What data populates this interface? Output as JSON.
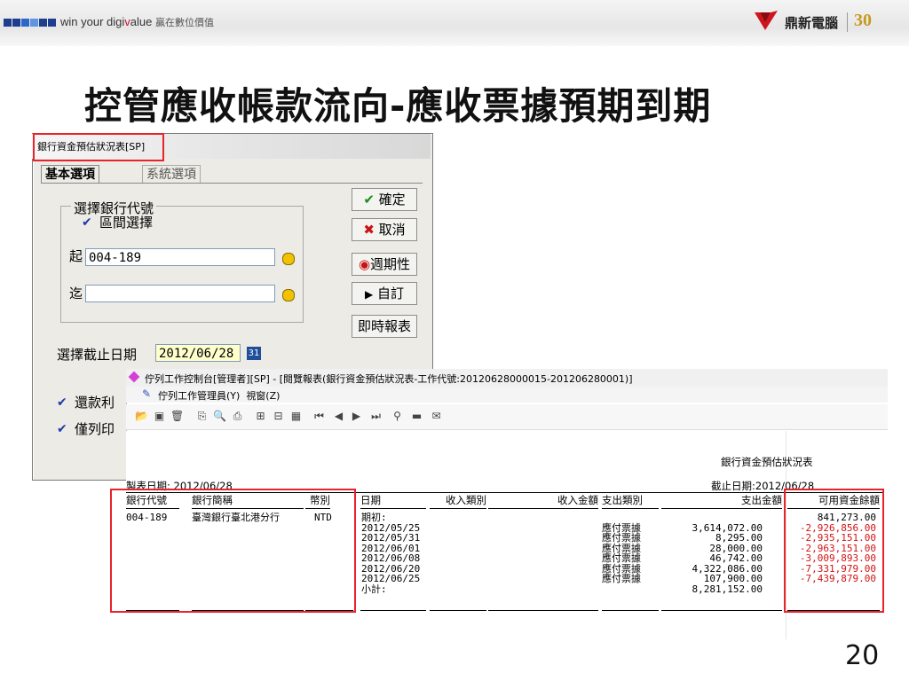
{
  "banner": {
    "tagline_a": "win your digi",
    "tagline_v": "v",
    "tagline_b": "alue",
    "tagline_cn": "贏在數位價值",
    "brand": "鼎新電腦",
    "anniversary": "30",
    "square_colors": [
      "#1f3d8f",
      "#1f3d8f",
      "#2d67c9",
      "#5f95e0",
      "#1f3d8f",
      "#1f3d8f",
      "#1f3d8f"
    ]
  },
  "slide_title": "控管應收帳款流向-應收票據預期到期",
  "dialog": {
    "title": "銀行資金預估狀況表[SP]",
    "tab_basic": "基本選項",
    "tab_system": "系統選項",
    "group_label": "選擇銀行代號",
    "range_checkbox": "區間選擇",
    "from_label": "起",
    "from_value": "004-189",
    "to_label": "迄",
    "to_value": "",
    "date_label": "選擇截止日期",
    "date_value": "2012/06/28",
    "calendar_glyph": "31",
    "check_repay": "還款利",
    "check_only": "僅列印",
    "buttons": {
      "ok": "確定",
      "cancel": "取消",
      "cycle": "週期性",
      "custom": "自訂",
      "instant": "即時報表"
    }
  },
  "report_window": {
    "title": "佇列工作控制台[管理者][SP] - [閱覽報表(銀行資金預估狀況表-工作代號:20120628000015-201206280001)]",
    "menu_queue": "佇列工作管理員(Y)",
    "menu_window": "視窗(Z)"
  },
  "report": {
    "title": "銀行資金預估狀況表",
    "print_date": "製表日期: 2012/06/28",
    "cutoff_date": "截止日期:2012/06/28",
    "headers": [
      "銀行代號",
      "銀行簡稱",
      "幣別",
      "日期",
      "收入類別",
      "收入金額",
      "支出類別",
      "支出金額",
      "可用資金餘額"
    ],
    "bank_code": "004-189",
    "bank_name": "臺灣銀行臺北港分行",
    "currency": "NTD",
    "dates": "期初:\n2012/05/25\n2012/05/31\n2012/06/01\n2012/06/08\n2012/06/20\n2012/06/25\n小計:",
    "expense_types": "\n應付票據\n應付票據\n應付票據\n應付票據\n應付票據\n應付票據",
    "expense_amounts": "\n3,614,072.00\n8,295.00\n28,000.00\n46,742.00\n4,322,086.00\n107,900.00\n8,281,152.00",
    "opening_balance": "841,273.00",
    "balances": "-2,926,856.00\n-2,935,151.00\n-2,963,151.00\n-3,009,893.00\n-7,331,979.00\n-7,439,879.00"
  },
  "page_number": "20"
}
